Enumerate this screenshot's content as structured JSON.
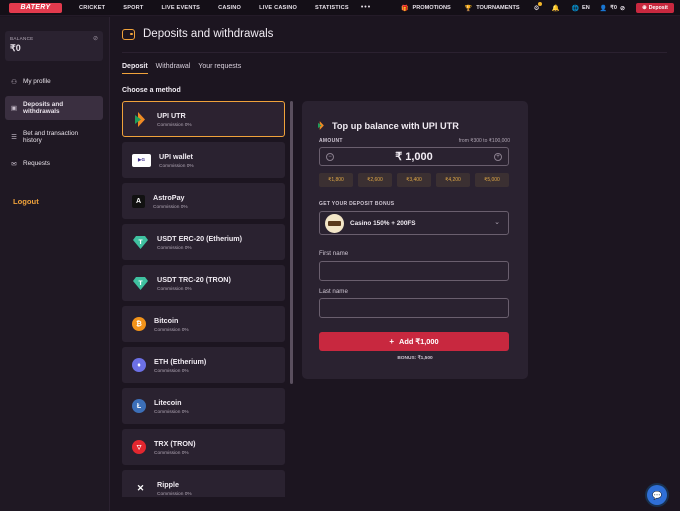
{
  "brand": {
    "logo_text": "BATERY"
  },
  "nav": [
    "CRICKET",
    "SPORT",
    "LIVE EVENTS",
    "CASINO",
    "LIVE CASINO",
    "STATISTICS"
  ],
  "nav_more": "•••",
  "top_right": {
    "promotions": "PROMOTIONS",
    "tournaments": "TOURNAMENTS",
    "language": "EN",
    "balance": "₹0",
    "deposit": "Deposit"
  },
  "sidebar": {
    "balance_label": "BALANCE",
    "balance_value": "₹0",
    "items": [
      {
        "label": "My profile",
        "icon": "user-icon"
      },
      {
        "label": "Deposits and withdrawals",
        "icon": "wallet-icon"
      },
      {
        "label": "Bet and transaction history",
        "icon": "list-icon"
      },
      {
        "label": "Requests",
        "icon": "message-icon"
      }
    ],
    "logout": "Logout"
  },
  "page": {
    "title": "Deposits and withdrawals",
    "tabs": [
      "Deposit",
      "Withdrawal",
      "Your requests"
    ],
    "choose_label": "Choose a method"
  },
  "methods": [
    {
      "name": "UPI UTR",
      "commission": "Commission 0%"
    },
    {
      "name": "UPI wallet",
      "commission": "Commission 0%"
    },
    {
      "name": "AstroPay",
      "commission": "Commission 0%"
    },
    {
      "name": "USDT ERC-20 (Etherium)",
      "commission": "Commission 0%"
    },
    {
      "name": "USDT TRC-20 (TRON)",
      "commission": "Commission 0%"
    },
    {
      "name": "Bitcoin",
      "commission": "Commission 0%"
    },
    {
      "name": "ETH (Etherium)",
      "commission": "Commission 0%"
    },
    {
      "name": "Litecoin",
      "commission": "Commission 0%"
    },
    {
      "name": "TRX (TRON)",
      "commission": "Commission 0%"
    },
    {
      "name": "Ripple",
      "commission": "Commission 0%"
    }
  ],
  "form": {
    "title": "Top up balance with UPI UTR",
    "amount_label": "AMOUNT",
    "range": "from ₹300 to ₹100,000",
    "amount_value": "₹ 1,000",
    "minus": "−",
    "plus": "+",
    "chips": [
      "₹1,800",
      "₹2,600",
      "₹3,400",
      "₹4,200",
      "₹5,000"
    ],
    "bonus_label": "GET YOUR DEPOSIT BONUS",
    "bonus_value": "Casino 150% + 200FS",
    "first_name_label": "First name",
    "last_name_label": "Last name",
    "add_button": "Add ₹1,000",
    "bonus_note": "BONUS: ₹1,500"
  },
  "colors": {
    "accent": "#f0a23b",
    "primary": "#c8283f",
    "background": "#1c1520",
    "card": "#2a2230"
  }
}
